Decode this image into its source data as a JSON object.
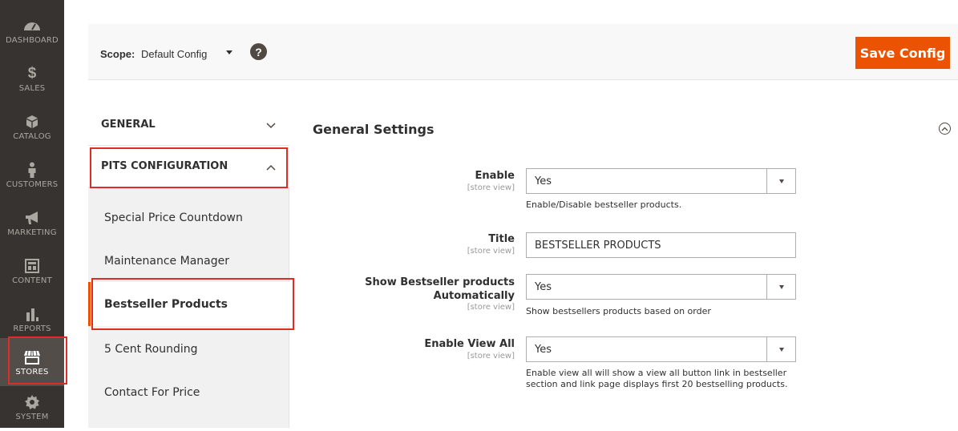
{
  "nav": {
    "items": [
      {
        "label": "DASHBOARD",
        "icon": "dashboard-icon"
      },
      {
        "label": "SALES",
        "icon": "dollar-icon"
      },
      {
        "label": "CATALOG",
        "icon": "box-icon"
      },
      {
        "label": "CUSTOMERS",
        "icon": "person-icon"
      },
      {
        "label": "MARKETING",
        "icon": "megaphone-icon"
      },
      {
        "label": "CONTENT",
        "icon": "layout-icon"
      },
      {
        "label": "REPORTS",
        "icon": "bar-chart-icon"
      },
      {
        "label": "STORES",
        "icon": "store-icon"
      },
      {
        "label": "SYSTEM",
        "icon": "gear-icon"
      }
    ],
    "active": "STORES"
  },
  "header": {
    "scope_label": "Scope:",
    "scope_value": "Default Config",
    "help": "?",
    "save_label": "Save Config"
  },
  "tabs": {
    "groups": [
      {
        "label": "GENERAL",
        "expanded": false
      },
      {
        "label": "PITS CONFIGURATION",
        "expanded": true
      }
    ],
    "items": [
      "Special Price Countdown",
      "Maintenance Manager",
      "Bestseller Products",
      "5 Cent Rounding",
      "Contact For Price"
    ],
    "active": "Bestseller Products"
  },
  "main": {
    "section_title": "General Settings",
    "fields": [
      {
        "label": "Enable",
        "scope": "[store view]",
        "value": "Yes",
        "note": "Enable/Disable bestseller products."
      },
      {
        "label": "Title",
        "scope": "[store view]",
        "value": "BESTSELLER PRODUCTS"
      },
      {
        "label_line1": "Show Bestseller products",
        "label_line2": "Automatically",
        "scope": "[store view]",
        "value": "Yes",
        "note": "Show bestsellers products based on order"
      },
      {
        "label": "Enable View All",
        "scope": "[store view]",
        "value": "Yes",
        "note_line1": "Enable view all will show a view all button link in bestseller",
        "note_line2": "section and link page displays first 20 bestselling products."
      }
    ]
  },
  "colors": {
    "nav_bg": "#373330",
    "accent": "#eb5202",
    "highlight": "#e02b27"
  }
}
